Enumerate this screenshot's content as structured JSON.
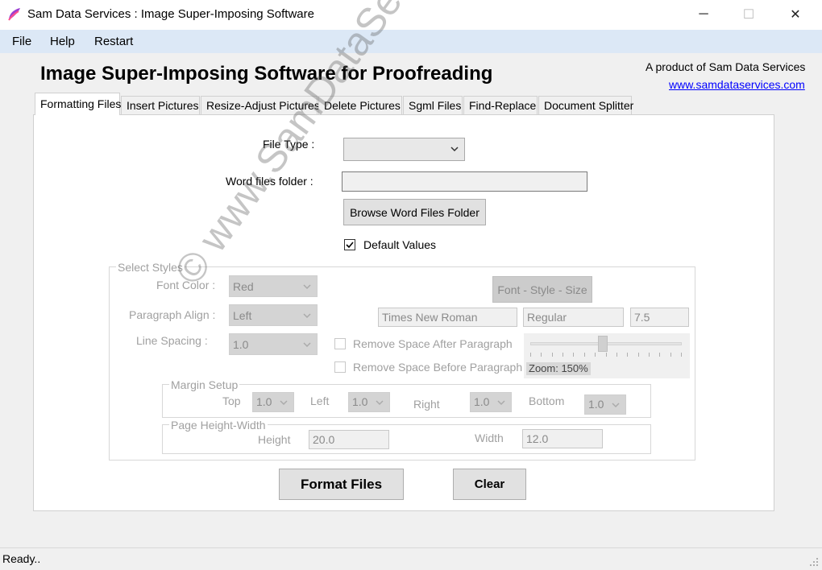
{
  "window": {
    "title": "Sam Data Services : Image Super-Imposing Software",
    "minimize": "─",
    "maximize": "☐",
    "close": "✕"
  },
  "menu": [
    "File",
    "Help",
    "Restart"
  ],
  "header": {
    "title": "Image Super-Imposing Software for Proofreading",
    "product_text": "A product of Sam Data Services",
    "website": "www.samdataservices.com"
  },
  "tabs": [
    "Formatting Files",
    "Insert Pictures",
    "Resize-Adjust Pictures",
    "Delete Pictures",
    "Sgml Files",
    "Find-Replace",
    "Document Splitter"
  ],
  "active_tab": "Formatting Files",
  "form": {
    "file_type_label": "File Type :",
    "file_type_value": "",
    "word_folder_label": "Word files  folder :",
    "word_folder_value": "",
    "browse_label": "Browse Word Files Folder",
    "default_values_label": "Default Values",
    "default_values_checked": true
  },
  "select_styles": {
    "group_label": "Select Styles",
    "font_color_label": "Font Color :",
    "font_color_value": "Red",
    "paragraph_align_label": "Paragraph Align :",
    "paragraph_align_value": "Left",
    "line_spacing_label": "Line Spacing :",
    "line_spacing_value": "1.0",
    "font_style_size_button": "Font - Style - Size",
    "font_name": "Times New Roman",
    "font_style": "Regular",
    "font_size": "7.5",
    "remove_after_label": "Remove Space After Paragraph",
    "remove_before_label": "Remove Space Before Paragraph",
    "zoom_label": "Zoom: 150%",
    "zoom_fraction": 0.48
  },
  "margin_setup": {
    "group_label": "Margin Setup",
    "top_label": "Top",
    "top_value": "1.0",
    "left_label": "Left",
    "left_value": "1.0",
    "right_label": "Right",
    "right_value": "1.0",
    "bottom_label": "Bottom",
    "bottom_value": "1.0"
  },
  "page_height_width": {
    "group_label": "Page Height-Width",
    "height_label": "Height",
    "height_value": "20.0",
    "width_label": "Width",
    "width_value": "12.0"
  },
  "actions": {
    "format_files": "Format Files",
    "clear": "Clear"
  },
  "status": "Ready..",
  "watermark": "© www.SamDataServices.com",
  "colors": {
    "menubar": "#dce8f6",
    "link": "#0000ff",
    "disabled_text": "#a0a0a0"
  }
}
